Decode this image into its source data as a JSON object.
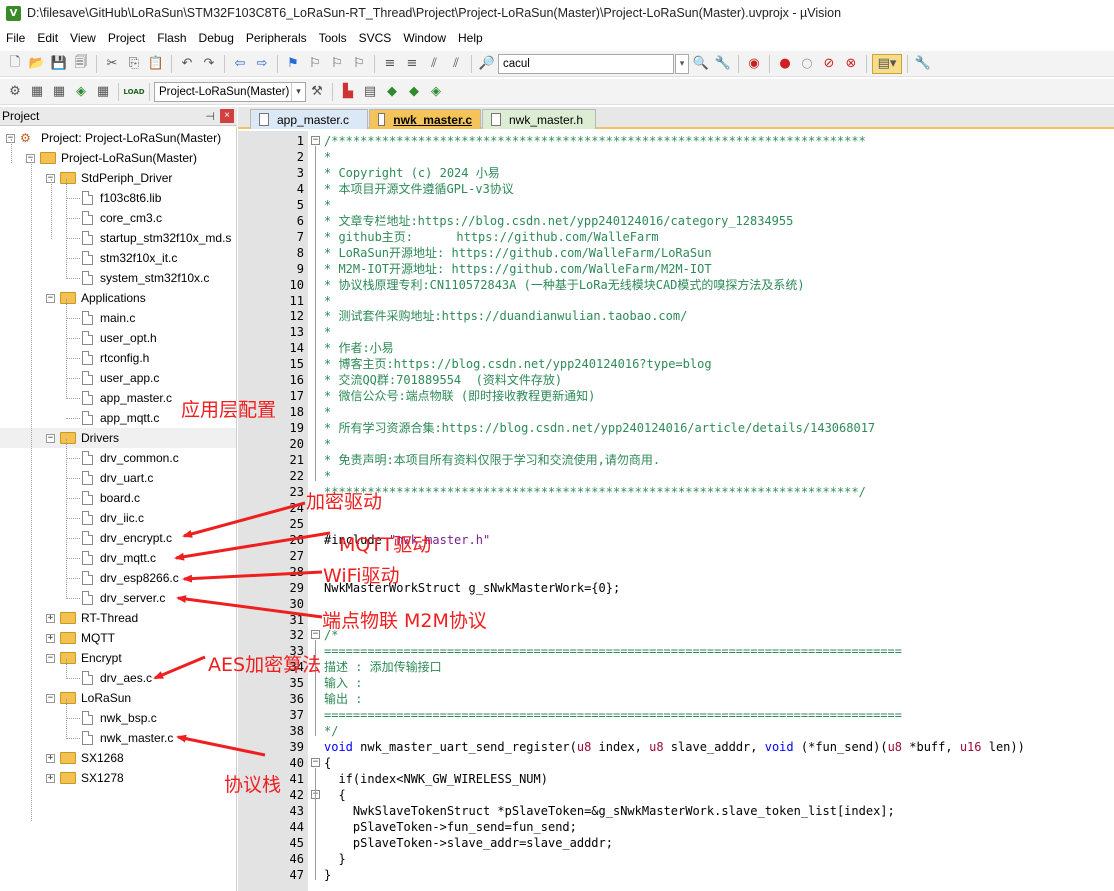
{
  "window": {
    "title": "D:\\filesave\\GitHub\\LoRaSun\\STM32F103C8T6_LoRaSun-RT_Thread\\Project\\Project-LoRaSun(Master)\\Project-LoRaSun(Master).uvprojx - µVision",
    "app_icon_letter": "V"
  },
  "menu": [
    "File",
    "Edit",
    "View",
    "Project",
    "Flash",
    "Debug",
    "Peripherals",
    "Tools",
    "SVCS",
    "Window",
    "Help"
  ],
  "toolbar": {
    "find_combo_value": "cacul",
    "target_combo_value": "Project-LoRaSun(Master)",
    "load_label": "LOAD"
  },
  "project_panel": {
    "title": "Project",
    "pin_glyph": "📌",
    "close_glyph": "×",
    "nodes": [
      {
        "label": "Project: Project-LoRaSun(Master)",
        "kind": "project",
        "expander": "−"
      },
      {
        "label": "Project-LoRaSun(Master)",
        "kind": "target",
        "expander": "−"
      },
      {
        "label": "StdPeriph_Driver",
        "kind": "folder",
        "expander": "−"
      },
      {
        "label": "f103c8t6.lib",
        "kind": "file"
      },
      {
        "label": "core_cm3.c",
        "kind": "file"
      },
      {
        "label": "startup_stm32f10x_md.s",
        "kind": "file"
      },
      {
        "label": "stm32f10x_it.c",
        "kind": "file"
      },
      {
        "label": "system_stm32f10x.c",
        "kind": "file"
      },
      {
        "label": "Applications",
        "kind": "folder",
        "expander": "−"
      },
      {
        "label": "main.c",
        "kind": "file"
      },
      {
        "label": "user_opt.h",
        "kind": "file"
      },
      {
        "label": "rtconfig.h",
        "kind": "file"
      },
      {
        "label": "user_app.c",
        "kind": "file"
      },
      {
        "label": "app_master.c",
        "kind": "file"
      },
      {
        "label": "app_mqtt.c",
        "kind": "file"
      },
      {
        "label": "Drivers",
        "kind": "folder",
        "expander": "−"
      },
      {
        "label": "drv_common.c",
        "kind": "file"
      },
      {
        "label": "drv_uart.c",
        "kind": "file"
      },
      {
        "label": "board.c",
        "kind": "file"
      },
      {
        "label": "drv_iic.c",
        "kind": "file"
      },
      {
        "label": "drv_encrypt.c",
        "kind": "file"
      },
      {
        "label": "drv_mqtt.c",
        "kind": "file"
      },
      {
        "label": "drv_esp8266.c",
        "kind": "file"
      },
      {
        "label": "drv_server.c",
        "kind": "file"
      },
      {
        "label": "RT-Thread",
        "kind": "folder",
        "expander": "+"
      },
      {
        "label": "MQTT",
        "kind": "folder",
        "expander": "+"
      },
      {
        "label": "Encrypt",
        "kind": "folder",
        "expander": "−"
      },
      {
        "label": "drv_aes.c",
        "kind": "file"
      },
      {
        "label": "LoRaSun",
        "kind": "folder",
        "expander": "−"
      },
      {
        "label": "nwk_bsp.c",
        "kind": "file"
      },
      {
        "label": "nwk_master.c",
        "kind": "file"
      },
      {
        "label": "SX1268",
        "kind": "folder",
        "expander": "+"
      },
      {
        "label": "SX1278",
        "kind": "folder",
        "expander": "+"
      }
    ]
  },
  "tabs": [
    {
      "label": "app_master.c",
      "state": "inactive"
    },
    {
      "label": "nwk_master.c",
      "state": "active"
    },
    {
      "label": "nwk_master.h",
      "state": "inactive"
    }
  ],
  "editor": {
    "lines": [
      {
        "n": "1",
        "fold": "−",
        "parts": [
          {
            "t": "/**************************************************************************",
            "c": "c-comment"
          }
        ]
      },
      {
        "n": "2",
        "parts": [
          {
            "t": "*",
            "c": "c-comment"
          }
        ]
      },
      {
        "n": "3",
        "parts": [
          {
            "t": "* Copyright (c) 2024 小易",
            "c": "c-comment"
          }
        ]
      },
      {
        "n": "4",
        "parts": [
          {
            "t": "* 本项目开源文件遵循GPL-v3协议",
            "c": "c-comment"
          }
        ]
      },
      {
        "n": "5",
        "parts": [
          {
            "t": "*",
            "c": "c-comment"
          }
        ]
      },
      {
        "n": "6",
        "parts": [
          {
            "t": "* 文章专栏地址:https://blog.csdn.net/ypp240124016/category_12834955",
            "c": "c-comment"
          }
        ]
      },
      {
        "n": "7",
        "parts": [
          {
            "t": "* github主页:      https://github.com/WalleFarm",
            "c": "c-comment"
          }
        ]
      },
      {
        "n": "8",
        "parts": [
          {
            "t": "* LoRaSun开源地址: https://github.com/WalleFarm/LoRaSun",
            "c": "c-comment"
          }
        ]
      },
      {
        "n": "9",
        "parts": [
          {
            "t": "* M2M-IOT开源地址: https://github.com/WalleFarm/M2M-IOT",
            "c": "c-comment"
          }
        ]
      },
      {
        "n": "10",
        "parts": [
          {
            "t": "* 协议栈原理专利:CN110572843A (一种基于LoRa无线模块CAD模式的嗅探方法及系统)",
            "c": "c-comment"
          }
        ]
      },
      {
        "n": "11",
        "parts": [
          {
            "t": "*",
            "c": "c-comment"
          }
        ]
      },
      {
        "n": "12",
        "parts": [
          {
            "t": "* 测试套件采购地址:https://duandianwulian.taobao.com/",
            "c": "c-comment"
          }
        ]
      },
      {
        "n": "13",
        "parts": [
          {
            "t": "*",
            "c": "c-comment"
          }
        ]
      },
      {
        "n": "14",
        "parts": [
          {
            "t": "* 作者:小易",
            "c": "c-comment"
          }
        ]
      },
      {
        "n": "15",
        "parts": [
          {
            "t": "* 博客主页:https://blog.csdn.net/ypp240124016?type=blog",
            "c": "c-comment"
          }
        ]
      },
      {
        "n": "16",
        "parts": [
          {
            "t": "* 交流QQ群:701889554  (资料文件存放)",
            "c": "c-comment"
          }
        ]
      },
      {
        "n": "17",
        "parts": [
          {
            "t": "* 微信公众号:端点物联 (即时接收教程更新通知)",
            "c": "c-comment"
          }
        ]
      },
      {
        "n": "18",
        "parts": [
          {
            "t": "*",
            "c": "c-comment"
          }
        ]
      },
      {
        "n": "19",
        "parts": [
          {
            "t": "* 所有学习资源合集:https://blog.csdn.net/ypp240124016/article/details/143068017",
            "c": "c-comment"
          }
        ]
      },
      {
        "n": "20",
        "parts": [
          {
            "t": "*",
            "c": "c-comment"
          }
        ]
      },
      {
        "n": "21",
        "parts": [
          {
            "t": "* 免责声明:本项目所有资料仅限于学习和交流使用,请勿商用.",
            "c": "c-comment"
          }
        ]
      },
      {
        "n": "22",
        "parts": [
          {
            "t": "*",
            "c": "c-comment"
          }
        ]
      },
      {
        "n": "23",
        "parts": [
          {
            "t": "**************************************************************************/",
            "c": "c-comment"
          }
        ]
      },
      {
        "n": "24",
        "parts": []
      },
      {
        "n": "25",
        "parts": []
      },
      {
        "n": "26",
        "parts": [
          {
            "t": "#include ",
            "c": "c-plain"
          },
          {
            "t": "\"nwk_master.h\"",
            "c": "c-str"
          }
        ]
      },
      {
        "n": "27",
        "parts": []
      },
      {
        "n": "28",
        "parts": []
      },
      {
        "n": "29",
        "parts": [
          {
            "t": "NwkMasterWorkStruct g_sNwkMasterWork={0};",
            "c": "c-plain"
          }
        ]
      },
      {
        "n": "30",
        "parts": []
      },
      {
        "n": "31",
        "parts": []
      },
      {
        "n": "32",
        "fold": "−",
        "parts": [
          {
            "t": "/*",
            "c": "c-comment"
          }
        ]
      },
      {
        "n": "33",
        "parts": [
          {
            "t": "================================================================================",
            "c": "c-comment"
          }
        ]
      },
      {
        "n": "34",
        "parts": [
          {
            "t": "描述 : 添加传输接口",
            "c": "c-comment"
          }
        ]
      },
      {
        "n": "35",
        "parts": [
          {
            "t": "输入 :",
            "c": "c-comment"
          }
        ]
      },
      {
        "n": "36",
        "parts": [
          {
            "t": "输出 :",
            "c": "c-comment"
          }
        ]
      },
      {
        "n": "37",
        "parts": [
          {
            "t": "================================================================================",
            "c": "c-comment"
          }
        ]
      },
      {
        "n": "38",
        "parts": [
          {
            "t": "*/",
            "c": "c-comment"
          }
        ]
      },
      {
        "n": "39",
        "parts": [
          {
            "t": "void",
            "c": "c-kw"
          },
          {
            "t": " nwk_master_uart_send_register(",
            "c": "c-plain"
          },
          {
            "t": "u8",
            "c": "c-type"
          },
          {
            "t": " index, ",
            "c": "c-plain"
          },
          {
            "t": "u8",
            "c": "c-type"
          },
          {
            "t": " slave_adddr, ",
            "c": "c-plain"
          },
          {
            "t": "void",
            "c": "c-kw"
          },
          {
            "t": " (*fun_send)(",
            "c": "c-plain"
          },
          {
            "t": "u8",
            "c": "c-type"
          },
          {
            "t": " *buff, ",
            "c": "c-plain"
          },
          {
            "t": "u16",
            "c": "c-type"
          },
          {
            "t": " len))",
            "c": "c-plain"
          }
        ]
      },
      {
        "n": "40",
        "fold": "−",
        "parts": [
          {
            "t": "{",
            "c": "c-plain"
          }
        ]
      },
      {
        "n": "41",
        "parts": [
          {
            "t": "  if(index<NWK_GW_WIRELESS_NUM)",
            "c": "c-plain"
          }
        ]
      },
      {
        "n": "42",
        "fold": "−",
        "parts": [
          {
            "t": "  {",
            "c": "c-plain"
          }
        ]
      },
      {
        "n": "43",
        "parts": [
          {
            "t": "    NwkSlaveTokenStruct *pSlaveToken=&g_sNwkMasterWork.slave_token_list[index];",
            "c": "c-plain"
          }
        ]
      },
      {
        "n": "44",
        "parts": [
          {
            "t": "    pSlaveToken->fun_send=fun_send;",
            "c": "c-plain"
          }
        ]
      },
      {
        "n": "45",
        "parts": [
          {
            "t": "    pSlaveToken->slave_addr=slave_adddr;",
            "c": "c-plain"
          }
        ]
      },
      {
        "n": "46",
        "parts": [
          {
            "t": "  }",
            "c": "c-plain"
          }
        ]
      },
      {
        "n": "47",
        "parts": [
          {
            "t": "}",
            "c": "c-plain"
          }
        ]
      }
    ]
  },
  "annotations": {
    "app_config": "应用层配置",
    "encrypt_driver": "加密驱动",
    "mqtt_driver": "MQTT驱动",
    "wifi_driver": "WiFi驱动",
    "m2m_protocol": "端点物联 M2M协议",
    "aes_algorithm": "AES加密算法",
    "protocol_stack": "协议栈",
    "color": "#ef1f1f"
  }
}
